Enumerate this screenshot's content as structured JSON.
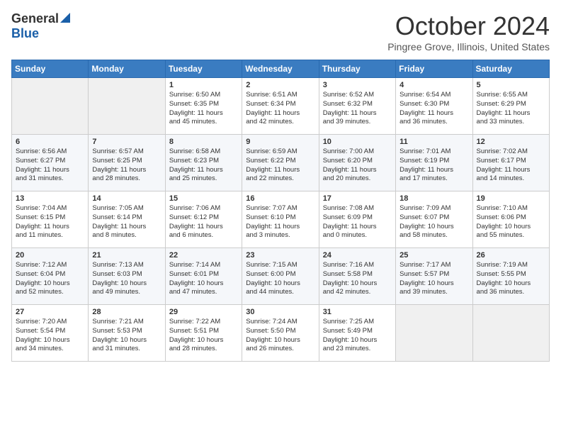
{
  "header": {
    "logo_general": "General",
    "logo_blue": "Blue",
    "month_title": "October 2024",
    "location": "Pingree Grove, Illinois, United States"
  },
  "days_of_week": [
    "Sunday",
    "Monday",
    "Tuesday",
    "Wednesday",
    "Thursday",
    "Friday",
    "Saturday"
  ],
  "weeks": [
    [
      {
        "num": "",
        "info": ""
      },
      {
        "num": "",
        "info": ""
      },
      {
        "num": "1",
        "info": "Sunrise: 6:50 AM\nSunset: 6:35 PM\nDaylight: 11 hours\nand 45 minutes."
      },
      {
        "num": "2",
        "info": "Sunrise: 6:51 AM\nSunset: 6:34 PM\nDaylight: 11 hours\nand 42 minutes."
      },
      {
        "num": "3",
        "info": "Sunrise: 6:52 AM\nSunset: 6:32 PM\nDaylight: 11 hours\nand 39 minutes."
      },
      {
        "num": "4",
        "info": "Sunrise: 6:54 AM\nSunset: 6:30 PM\nDaylight: 11 hours\nand 36 minutes."
      },
      {
        "num": "5",
        "info": "Sunrise: 6:55 AM\nSunset: 6:29 PM\nDaylight: 11 hours\nand 33 minutes."
      }
    ],
    [
      {
        "num": "6",
        "info": "Sunrise: 6:56 AM\nSunset: 6:27 PM\nDaylight: 11 hours\nand 31 minutes."
      },
      {
        "num": "7",
        "info": "Sunrise: 6:57 AM\nSunset: 6:25 PM\nDaylight: 11 hours\nand 28 minutes."
      },
      {
        "num": "8",
        "info": "Sunrise: 6:58 AM\nSunset: 6:23 PM\nDaylight: 11 hours\nand 25 minutes."
      },
      {
        "num": "9",
        "info": "Sunrise: 6:59 AM\nSunset: 6:22 PM\nDaylight: 11 hours\nand 22 minutes."
      },
      {
        "num": "10",
        "info": "Sunrise: 7:00 AM\nSunset: 6:20 PM\nDaylight: 11 hours\nand 20 minutes."
      },
      {
        "num": "11",
        "info": "Sunrise: 7:01 AM\nSunset: 6:19 PM\nDaylight: 11 hours\nand 17 minutes."
      },
      {
        "num": "12",
        "info": "Sunrise: 7:02 AM\nSunset: 6:17 PM\nDaylight: 11 hours\nand 14 minutes."
      }
    ],
    [
      {
        "num": "13",
        "info": "Sunrise: 7:04 AM\nSunset: 6:15 PM\nDaylight: 11 hours\nand 11 minutes."
      },
      {
        "num": "14",
        "info": "Sunrise: 7:05 AM\nSunset: 6:14 PM\nDaylight: 11 hours\nand 8 minutes."
      },
      {
        "num": "15",
        "info": "Sunrise: 7:06 AM\nSunset: 6:12 PM\nDaylight: 11 hours\nand 6 minutes."
      },
      {
        "num": "16",
        "info": "Sunrise: 7:07 AM\nSunset: 6:10 PM\nDaylight: 11 hours\nand 3 minutes."
      },
      {
        "num": "17",
        "info": "Sunrise: 7:08 AM\nSunset: 6:09 PM\nDaylight: 11 hours\nand 0 minutes."
      },
      {
        "num": "18",
        "info": "Sunrise: 7:09 AM\nSunset: 6:07 PM\nDaylight: 10 hours\nand 58 minutes."
      },
      {
        "num": "19",
        "info": "Sunrise: 7:10 AM\nSunset: 6:06 PM\nDaylight: 10 hours\nand 55 minutes."
      }
    ],
    [
      {
        "num": "20",
        "info": "Sunrise: 7:12 AM\nSunset: 6:04 PM\nDaylight: 10 hours\nand 52 minutes."
      },
      {
        "num": "21",
        "info": "Sunrise: 7:13 AM\nSunset: 6:03 PM\nDaylight: 10 hours\nand 49 minutes."
      },
      {
        "num": "22",
        "info": "Sunrise: 7:14 AM\nSunset: 6:01 PM\nDaylight: 10 hours\nand 47 minutes."
      },
      {
        "num": "23",
        "info": "Sunrise: 7:15 AM\nSunset: 6:00 PM\nDaylight: 10 hours\nand 44 minutes."
      },
      {
        "num": "24",
        "info": "Sunrise: 7:16 AM\nSunset: 5:58 PM\nDaylight: 10 hours\nand 42 minutes."
      },
      {
        "num": "25",
        "info": "Sunrise: 7:17 AM\nSunset: 5:57 PM\nDaylight: 10 hours\nand 39 minutes."
      },
      {
        "num": "26",
        "info": "Sunrise: 7:19 AM\nSunset: 5:55 PM\nDaylight: 10 hours\nand 36 minutes."
      }
    ],
    [
      {
        "num": "27",
        "info": "Sunrise: 7:20 AM\nSunset: 5:54 PM\nDaylight: 10 hours\nand 34 minutes."
      },
      {
        "num": "28",
        "info": "Sunrise: 7:21 AM\nSunset: 5:53 PM\nDaylight: 10 hours\nand 31 minutes."
      },
      {
        "num": "29",
        "info": "Sunrise: 7:22 AM\nSunset: 5:51 PM\nDaylight: 10 hours\nand 28 minutes."
      },
      {
        "num": "30",
        "info": "Sunrise: 7:24 AM\nSunset: 5:50 PM\nDaylight: 10 hours\nand 26 minutes."
      },
      {
        "num": "31",
        "info": "Sunrise: 7:25 AM\nSunset: 5:49 PM\nDaylight: 10 hours\nand 23 minutes."
      },
      {
        "num": "",
        "info": ""
      },
      {
        "num": "",
        "info": ""
      }
    ]
  ]
}
